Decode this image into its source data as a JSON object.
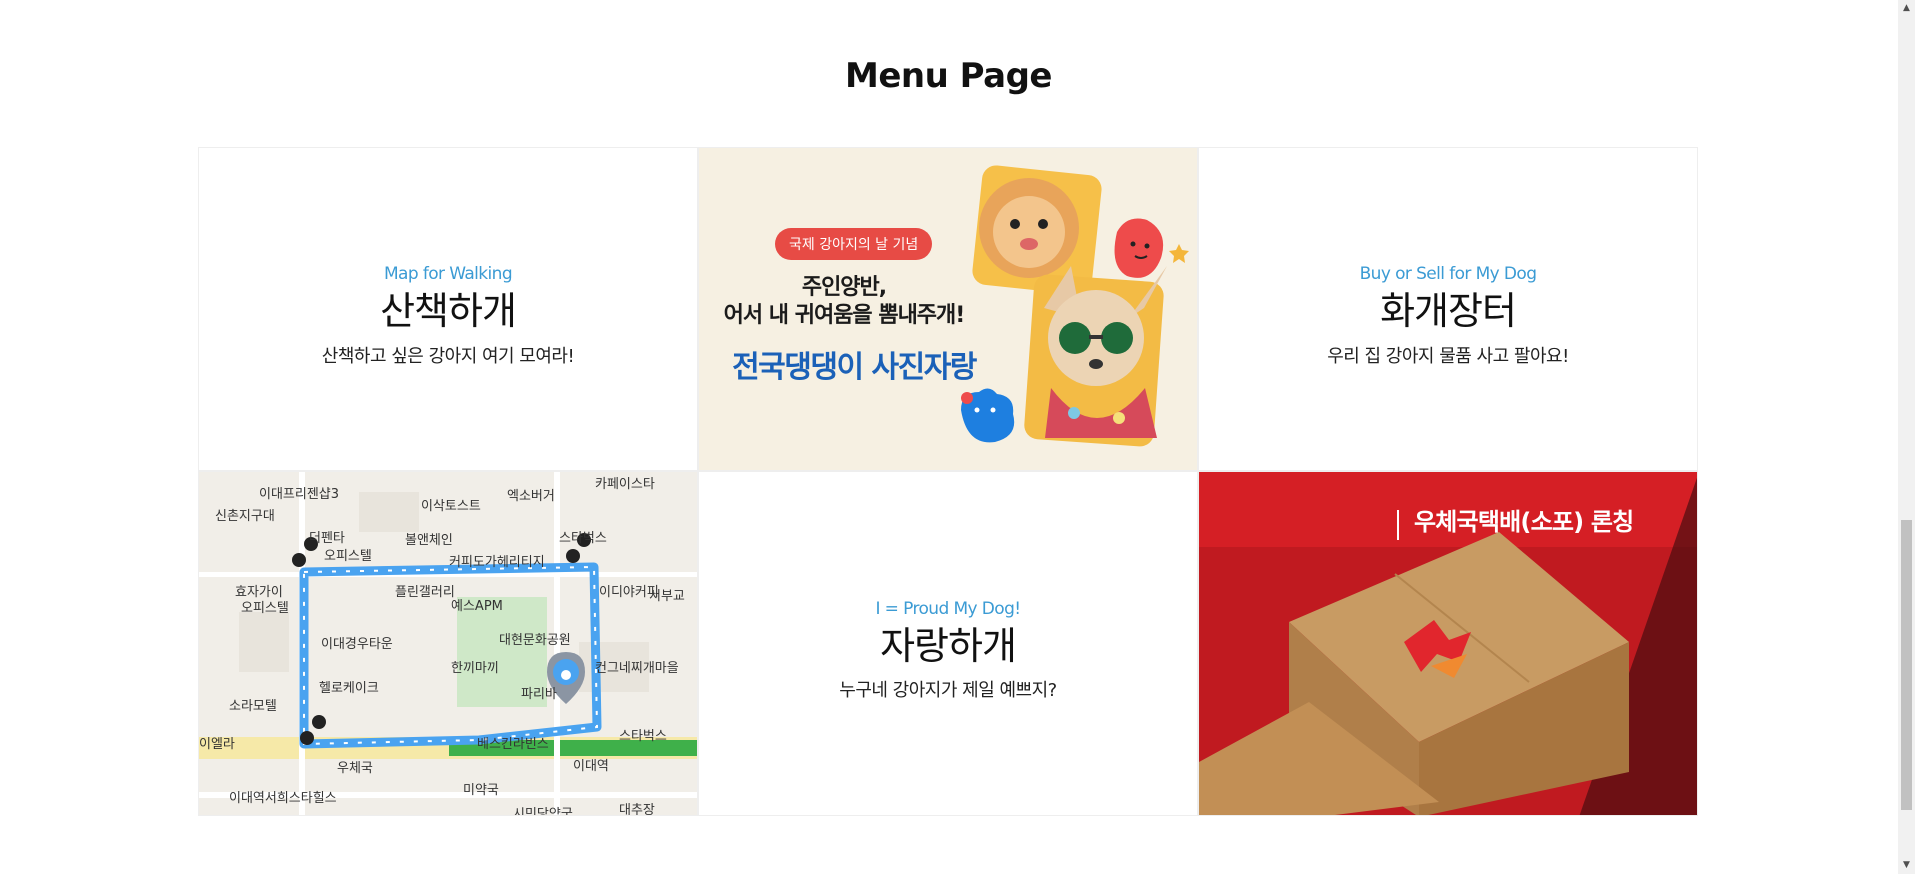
{
  "page": {
    "title": "Menu Page"
  },
  "menu": {
    "walk": {
      "eyebrow": "Map for Walking",
      "title": "산책하개",
      "desc": "산책하고 싶은 강아지 여기 모여라!"
    },
    "market": {
      "eyebrow": "Buy or Sell for My Dog",
      "title": "화개장터",
      "desc": "우리 집 강아지 물품 사고 팔아요!"
    },
    "proud": {
      "eyebrow": "I = Proud My Dog!",
      "title": "자랑하개",
      "desc": "누구네 강아지가 제일 예쁘지?"
    },
    "promo": {
      "badge": "국제 강아지의 날 기념",
      "line1": "주인양반,",
      "line2": "어서 내 귀여움을 뽐내주개!",
      "headline": "전국댕댕이 사진자랑"
    },
    "map": {
      "labels": [
        "이대프리젠샵3",
        "신촌지구대",
        "더펜타",
        "오피스텔",
        "효자가이",
        "오피스텔",
        "이대경우타운",
        "헬로케이크",
        "소라모텔",
        "이엘라",
        "우체국",
        "이대역서희스타힐스",
        "엑소버거",
        "이삭토스트",
        "볼앤체인",
        "커피도가헤리티지",
        "예스APM",
        "대현문화공원",
        "한끼마끼",
        "파리바",
        "베스킨라빈스",
        "이대역",
        "미약국",
        "시민당약국",
        "스타벅스",
        "대추장",
        "서부교",
        "이디야커피",
        "카페이스타",
        "스타벅스",
        "컨그네찌개마을",
        "플린갤러리"
      ]
    },
    "parcel": {
      "headline": "우체국택배(소포) 론칭"
    }
  },
  "colors": {
    "accent": "#3b9bd4",
    "route": "#4aa3f0",
    "promo_blue": "#1b61b8",
    "promo_red": "#e74b45",
    "parcel_red": "#d71f26"
  }
}
